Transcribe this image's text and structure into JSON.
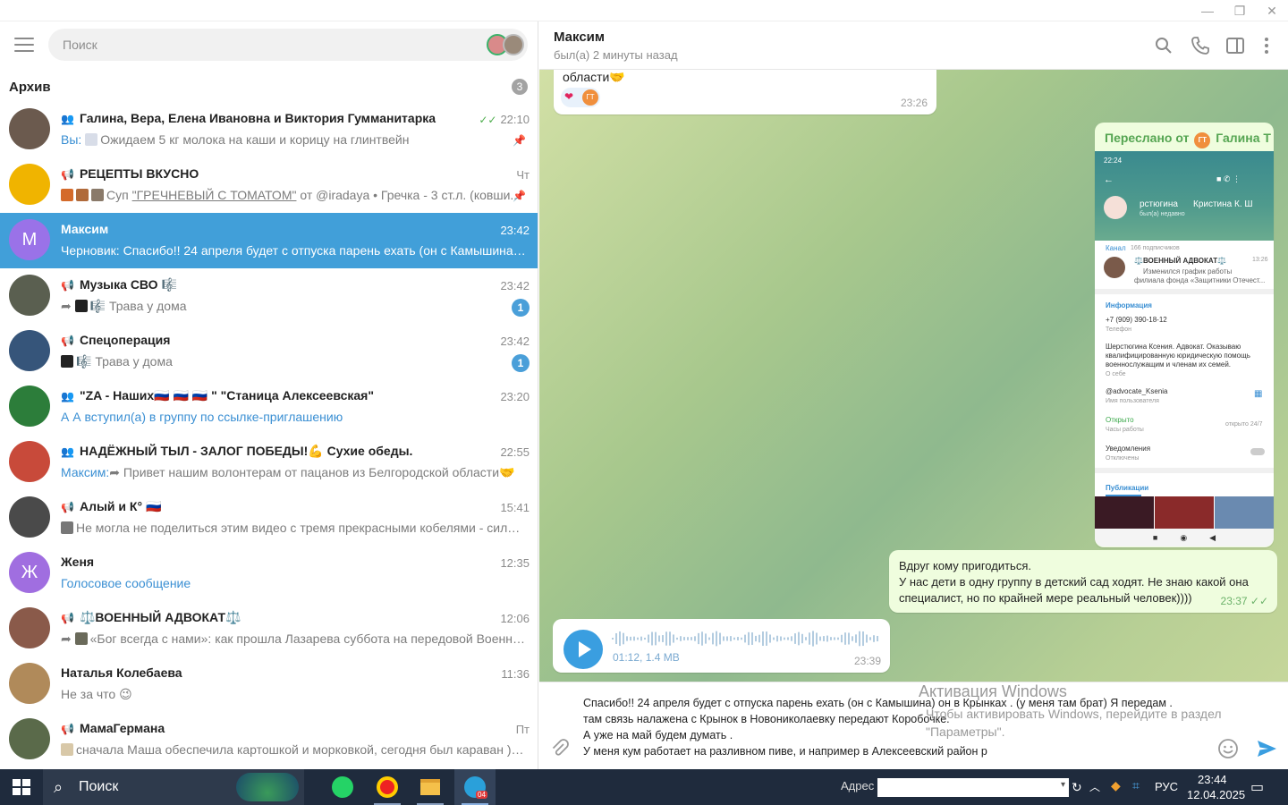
{
  "window": {
    "minimize": "—",
    "maximize": "❐",
    "close": "✕"
  },
  "sidebar": {
    "search_placeholder": "Поиск",
    "archive": {
      "label": "Архив",
      "count": "3"
    },
    "chats": [
      {
        "name": "Галина, Вера, Елена Ивановна и Виктория Гумманитарка",
        "time": "22:10",
        "who": "Вы:",
        "msg": "Ожидаем 5 кг молока на каши и корицу на глинтвейн",
        "read_check": "✓✓",
        "pinned": true,
        "av_color": "#6b5a4e"
      },
      {
        "name": "РЕЦЕПТЫ ВКУСНО",
        "time": "Чт",
        "msg_pre": "Суп ",
        "msg_link": "\"ГРЕЧНЕВЫЙ С ТОМАТОМ\"",
        "msg_post": " от @iradaya  • Гречка - 3 ст.л. (ковши...",
        "pinned": true,
        "av_color": "#f0b400"
      },
      {
        "name": "Максим",
        "time": "23:42",
        "who": "Черновик:",
        "msg": "Спасибо!! 24 апреля будет с отпуска парень ехать (он с Камышина) он в...",
        "av_letter": "М",
        "av_color": "#9a72e8",
        "active": true
      },
      {
        "name": "Музыка СВО 🎼",
        "time": "23:42",
        "msg": "🎼 Трава у дома",
        "badge": "1",
        "av_color": "#5a5f50"
      },
      {
        "name": "Спецоперация",
        "time": "23:42",
        "msg": "🎼 Трава у дома",
        "badge": "1",
        "av_color": "#36557a"
      },
      {
        "name": "\"ZA - Наших🇷🇺 🇷🇺 🇷🇺 \" \"Станица Алексеевская\"",
        "time": "23:20",
        "msg": "А А вступил(а) в группу по ссылке-приглашению",
        "msg_blue": true,
        "av_color": "#2c7d3a"
      },
      {
        "name": "НАДЁЖНЫЙ ТЫЛ - ЗАЛОГ ПОБЕДЫ!💪 Сухие обеды.",
        "time": "22:55",
        "who": "Максим:",
        "msg": "Привет  нашим  волонтерам от пацанов  из Белгородской области🤝",
        "av_color": "#c84a3a"
      },
      {
        "name": "Алый и К° 🇷🇺",
        "time": "15:41",
        "msg": "Не могла не поделиться этим видео с тремя прекрасными кобелями - сильны...",
        "av_color": "#4a4a4a"
      },
      {
        "name": "Женя",
        "time": "12:35",
        "msg": "Голосовое сообщение",
        "msg_blue": true,
        "av_letter": "Ж",
        "av_color": "#a06ee0"
      },
      {
        "name": "⚖️ВОЕННЫЙ АДВОКАТ⚖️",
        "time": "12:06",
        "msg": "«Бог всегда с нами»: как прошла Лазарева суббота на передовой  Военносл...",
        "av_color": "#8a5a4a"
      },
      {
        "name": "Наталья Колебаева",
        "time": "11:36",
        "msg": "Не за что 😉",
        "av_color": "#b08a5a"
      },
      {
        "name": "МамаГермана",
        "time": "Пт",
        "msg": "сначала Маша обеспечила картошкой и морковкой, сегодня был караван ) - с ...",
        "av_color": "#5a6a4a"
      }
    ]
  },
  "chat": {
    "title": "Максим",
    "status": "был(а) 2 минуты назад",
    "top_msg": {
      "text": "области🤝",
      "time": "23:26"
    },
    "forwarded": {
      "label": "Переслано от",
      "from_initials": "ГТ",
      "from": "Галина Т",
      "shot": {
        "clock": "22:24",
        "name1": "рстюгина",
        "name2": "Кристина К. Ш",
        "seen": "был(а) недавно",
        "channel": "Канал",
        "subs": "166 подписчиков",
        "ch_title": "⚖️ВОЕННЫЙ АДВОКАТ⚖️",
        "ch_time": "13:26",
        "ch_msg1": "Изменился график работы",
        "ch_msg2": "филиала фонда «Защитники Отечест...",
        "info": "Информация",
        "phone": "+7 (909) 390-18-12",
        "phone_lbl": "Телефон",
        "bio1": "Шерстюгина Ксения. Адвокат. Оказываю",
        "bio2": "квалифицированную юридическую помощь",
        "bio3": "военнослужащим и членам их семей.",
        "bio_lbl": "О себе",
        "username": "@advocate_Ksenia",
        "username_lbl": "Имя пользователя",
        "open": "Открыто",
        "hours_lbl": "Часы работы",
        "hours": "открыто 24/7",
        "notif": "Уведомления",
        "notif_state": "Отключены",
        "pubs": "Публикации"
      }
    },
    "out_msg": {
      "line1": "Вдруг кому пригодиться.",
      "line2": "У нас дети в одну группу в детский сад ходят.  Не знаю какой она",
      "line3": "специалист, но по крайней мере реальный человек))))",
      "time": "23:37",
      "check": "✓✓"
    },
    "voice": {
      "meta": "01:12, 1.4 MB",
      "time": "23:39"
    },
    "draft": [
      "Спасибо!! 24 апреля будет с отпуска парень ехать (он с Камышина) он в Крынках . (у меня там брат) Я передам .",
      "там связь налажена с Крынок в Новониколаевку передают Коробочке.",
      "А уже на май будем думать .",
      "У меня кум работает на разливном пиве, и например в Алексеевский район р"
    ],
    "activation": {
      "line1": "Активация Windows",
      "line2": "Чтобы активировать Windows, перейдите в раздел",
      "line3": "\"Параметры\"."
    }
  },
  "taskbar": {
    "search": "Поиск",
    "address": "Адрес",
    "lang": "РУС",
    "time": "23:44",
    "date": "12.04.2025",
    "tg_badge": "04"
  }
}
